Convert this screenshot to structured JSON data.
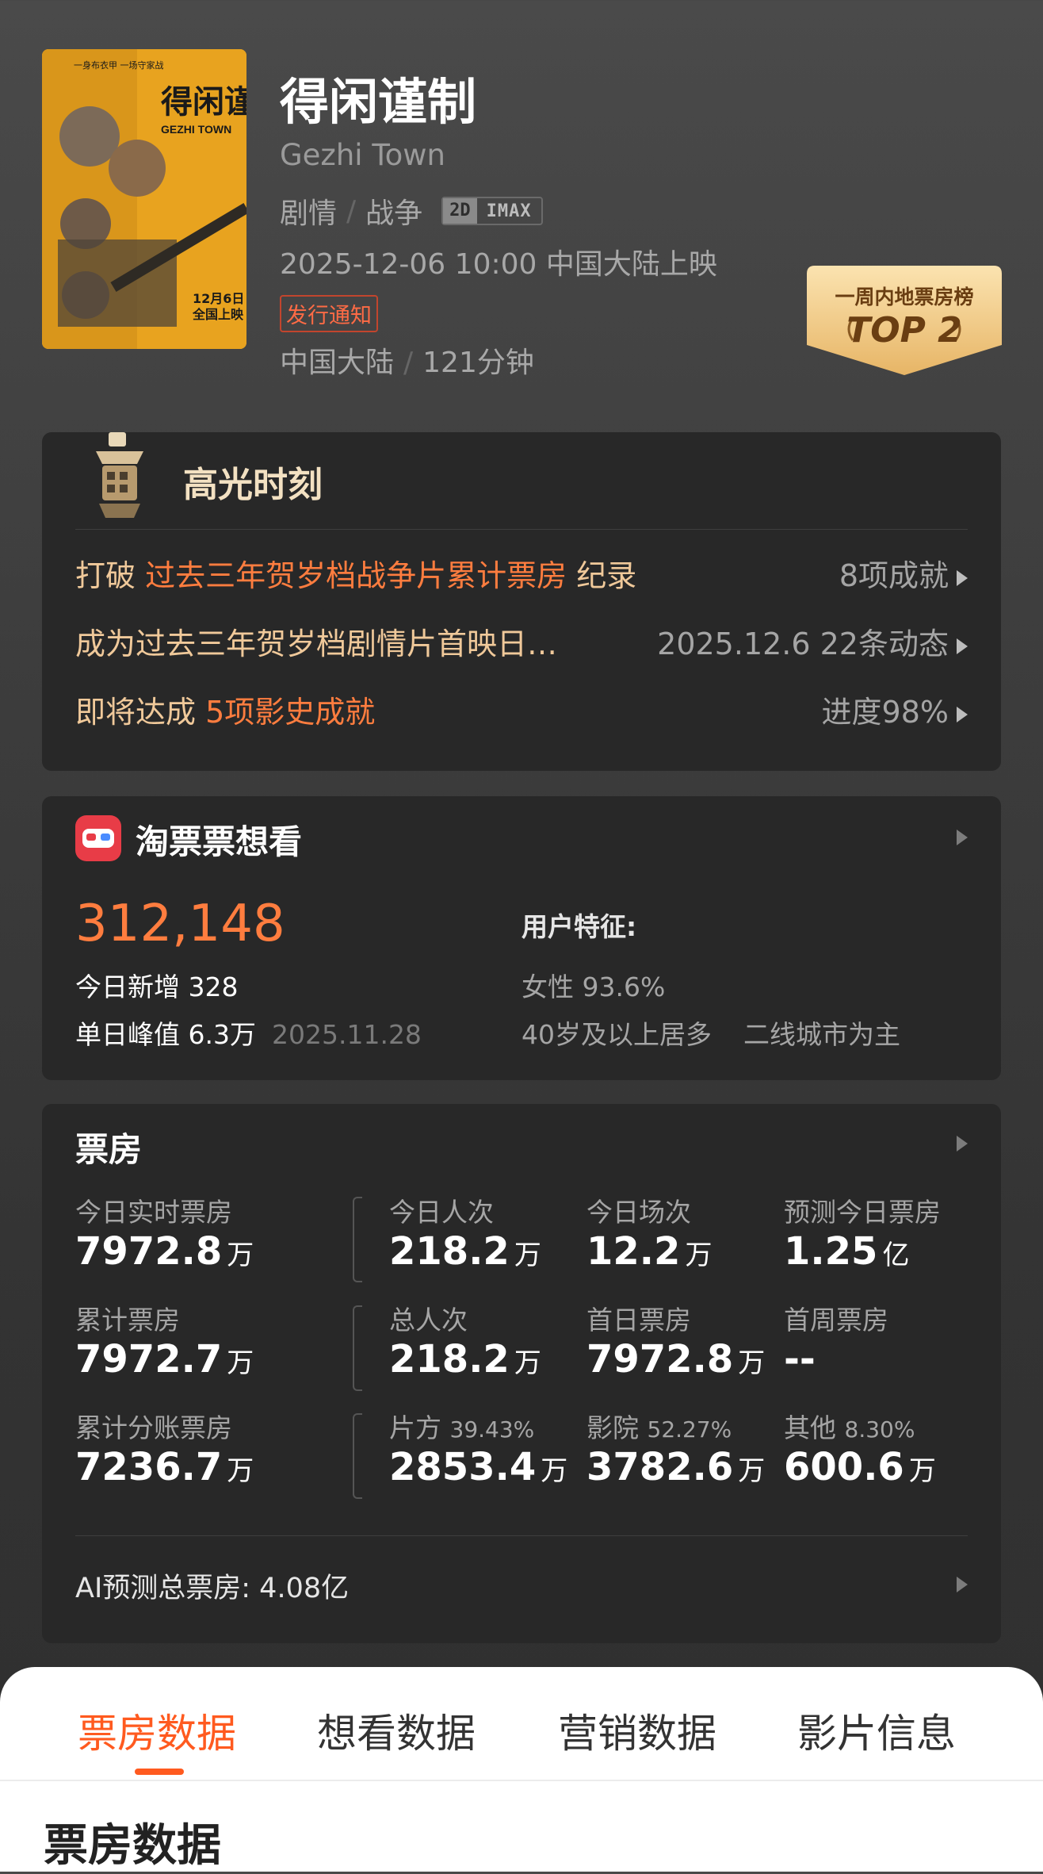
{
  "movie": {
    "title": "得闲谨制",
    "english_title": "Gezhi Town",
    "genre_1": "剧情",
    "genre_2": "战争",
    "format_1": "2D",
    "format_2": "IMAX",
    "release": "2025-12-06 10:00 中国大陆上映",
    "notice_tag": "发行通知",
    "region": "中国大陆",
    "duration": "121分钟",
    "poster": {
      "title_text": "得闲谨制",
      "english_text": "GEZHI TOWN",
      "tagline": "一身布衣甲 一场守家战",
      "date_text": "12月6日\n全国上映"
    }
  },
  "badge": {
    "line1": "一周内地票房榜",
    "line2": "TOP 2"
  },
  "highlights": {
    "title": "高光时刻",
    "rows": [
      {
        "prefix": "打破 ",
        "highlight": "过去三年贺岁档战争片累计票房",
        "suffix": " 纪录",
        "right": "8项成就"
      },
      {
        "prefix": "成为过去三年贺岁档剧情片首映日…",
        "highlight": "",
        "suffix": "",
        "right": "2025.12.6  22条动态"
      },
      {
        "prefix": "即将达成 ",
        "highlight": "5项影史成就",
        "suffix": "",
        "right": "进度98%"
      }
    ]
  },
  "want": {
    "title": "淘票票想看",
    "count": "312,148",
    "today_new": "今日新增 328",
    "peak": "单日峰值 6.3万",
    "peak_date": "2025.11.28",
    "user_label": "用户特征:",
    "female": "女性 93.6%",
    "age": "40岁及以上居多",
    "city": "二线城市为主"
  },
  "boxoffice": {
    "title": "票房",
    "row1": [
      {
        "label": "今日实时票房",
        "value": "7972.8",
        "unit": "万"
      },
      {
        "label": "今日人次",
        "value": "218.2",
        "unit": "万"
      },
      {
        "label": "今日场次",
        "value": "12.2",
        "unit": "万"
      },
      {
        "label": "预测今日票房",
        "value": "1.25",
        "unit": "亿"
      }
    ],
    "row2": [
      {
        "label": "累计票房",
        "value": "7972.7",
        "unit": "万"
      },
      {
        "label": "总人次",
        "value": "218.2",
        "unit": "万"
      },
      {
        "label": "首日票房",
        "value": "7972.8",
        "unit": "万"
      },
      {
        "label": "首周票房",
        "value": "--",
        "unit": ""
      }
    ],
    "row3": [
      {
        "label": "累计分账票房",
        "pct": "",
        "value": "7236.7",
        "unit": "万"
      },
      {
        "label": "片方",
        "pct": "39.43%",
        "value": "2853.4",
        "unit": "万"
      },
      {
        "label": "影院",
        "pct": "52.27%",
        "value": "3782.6",
        "unit": "万"
      },
      {
        "label": "其他",
        "pct": "8.30%",
        "value": "600.6",
        "unit": "万"
      }
    ],
    "ai_forecast": "AI预测总票房:  4.08亿"
  },
  "tabs": [
    "票房数据",
    "想看数据",
    "营销数据",
    "影片信息"
  ],
  "active_tab": 0,
  "section_title": "票房数据"
}
